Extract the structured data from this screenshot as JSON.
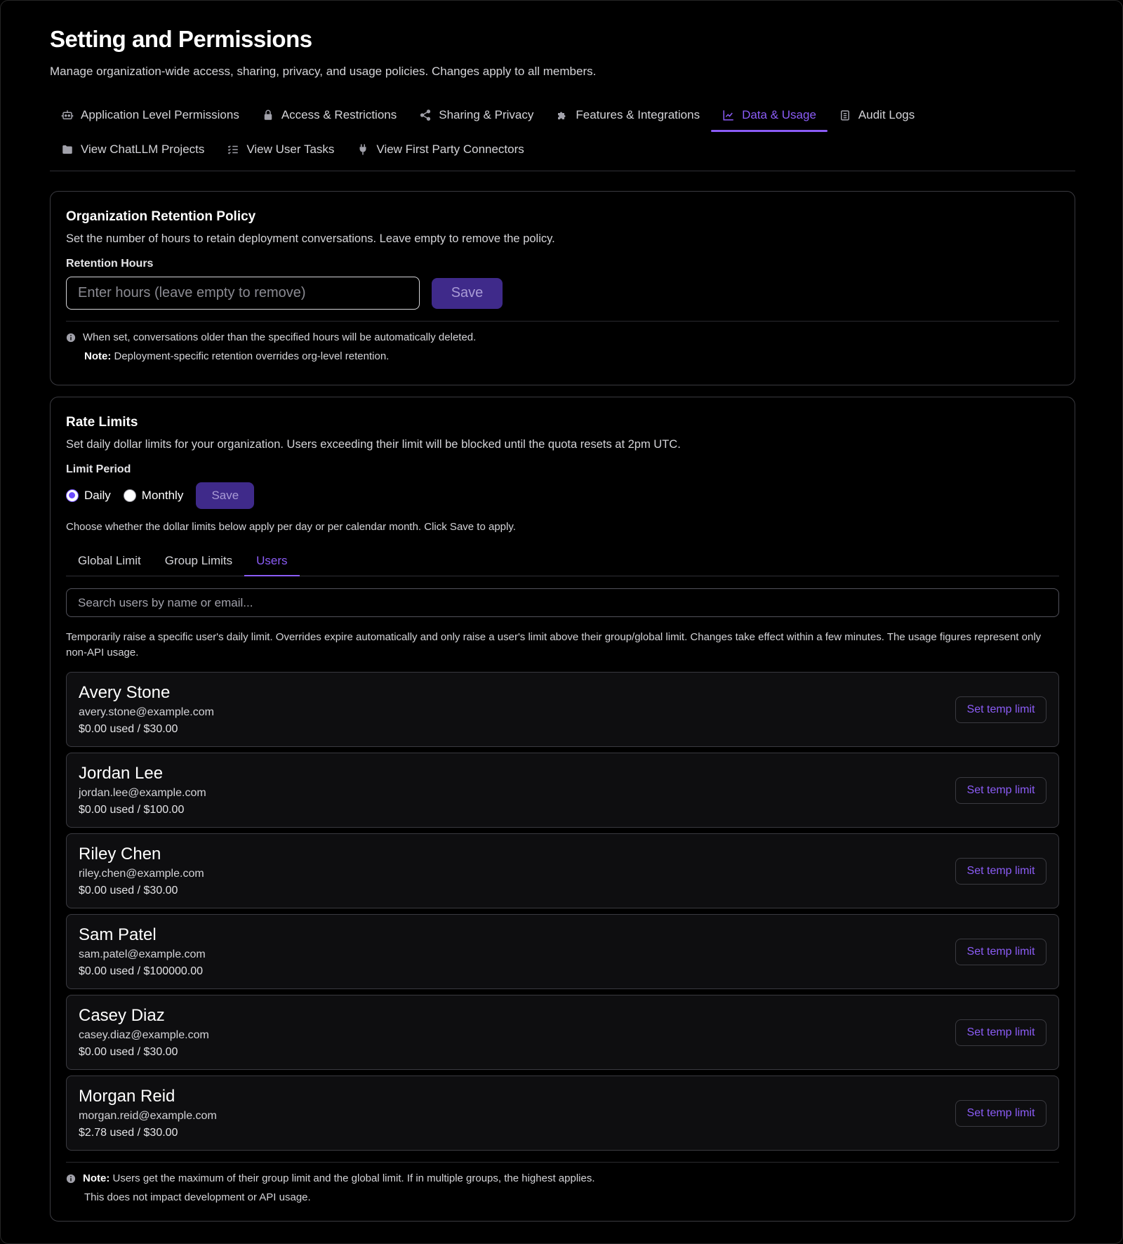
{
  "page": {
    "title": "Setting and Permissions",
    "subtitle": "Manage organization-wide access, sharing, privacy, and usage policies. Changes apply to all members."
  },
  "tabs": [
    {
      "label": "Application Level Permissions",
      "icon": "robot-icon",
      "active": false
    },
    {
      "label": "Access & Restrictions",
      "icon": "lock-icon",
      "active": false
    },
    {
      "label": "Sharing & Privacy",
      "icon": "share-icon",
      "active": false
    },
    {
      "label": "Features & Integrations",
      "icon": "puzzle-icon",
      "active": false
    },
    {
      "label": "Data & Usage",
      "icon": "chart-line-icon",
      "active": true
    },
    {
      "label": "Audit Logs",
      "icon": "clipboard-icon",
      "active": false
    },
    {
      "label": "View ChatLLM Projects",
      "icon": "folder-icon",
      "active": false
    },
    {
      "label": "View User Tasks",
      "icon": "list-check-icon",
      "active": false
    },
    {
      "label": "View First Party Connectors",
      "icon": "plug-icon",
      "active": false
    }
  ],
  "retention": {
    "title": "Organization Retention Policy",
    "description": "Set the number of hours to retain deployment conversations. Leave empty to remove the policy.",
    "field_label": "Retention Hours",
    "placeholder": "Enter hours (leave empty to remove)",
    "value": "",
    "save_label": "Save",
    "info": "When set, conversations older than the specified hours will be automatically deleted.",
    "note_label": "Note:",
    "note_text": " Deployment-specific retention overrides org-level retention."
  },
  "rate_limits": {
    "title": "Rate Limits",
    "description": "Set daily dollar limits for your organization. Users exceeding their limit will be blocked until the quota resets at 2pm UTC.",
    "period_label": "Limit Period",
    "options": [
      {
        "label": "Daily",
        "selected": true
      },
      {
        "label": "Monthly",
        "selected": false
      }
    ],
    "save_label": "Save",
    "hint": "Choose whether the dollar limits below apply per day or per calendar month. Click Save to apply.",
    "subtabs": [
      {
        "label": "Global Limit",
        "active": false
      },
      {
        "label": "Group Limits",
        "active": false
      },
      {
        "label": "Users",
        "active": true
      }
    ],
    "search_placeholder": "Search users by name or email...",
    "users_description": "Temporarily raise a specific user's daily limit. Overrides expire automatically and only raise a user's limit above their group/global limit. Changes take effect within a few minutes. The usage figures represent only non-API usage.",
    "temp_limit_label": "Set temp limit",
    "users": [
      {
        "name": "Avery Stone",
        "email": "avery.stone@example.com",
        "usage": "$0.00 used / $30.00"
      },
      {
        "name": "Jordan Lee",
        "email": "jordan.lee@example.com",
        "usage": "$0.00 used / $100.00"
      },
      {
        "name": "Riley Chen",
        "email": "riley.chen@example.com",
        "usage": "$0.00 used / $30.00"
      },
      {
        "name": "Sam Patel",
        "email": "sam.patel@example.com",
        "usage": "$0.00 used / $100000.00"
      },
      {
        "name": "Casey Diaz",
        "email": "casey.diaz@example.com",
        "usage": "$0.00 used / $30.00"
      },
      {
        "name": "Morgan Reid",
        "email": "morgan.reid@example.com",
        "usage": "$2.78 used / $30.00"
      }
    ],
    "note_label": "Note:",
    "note_text": " Users get the maximum of their group limit and the global limit. If in multiple groups, the highest applies.",
    "note_text2": "This does not impact development or API usage."
  },
  "colors": {
    "accent": "#8b5cf6",
    "button_bg": "#3f2a8a",
    "background": "#000000",
    "border": "#3a3a40"
  }
}
